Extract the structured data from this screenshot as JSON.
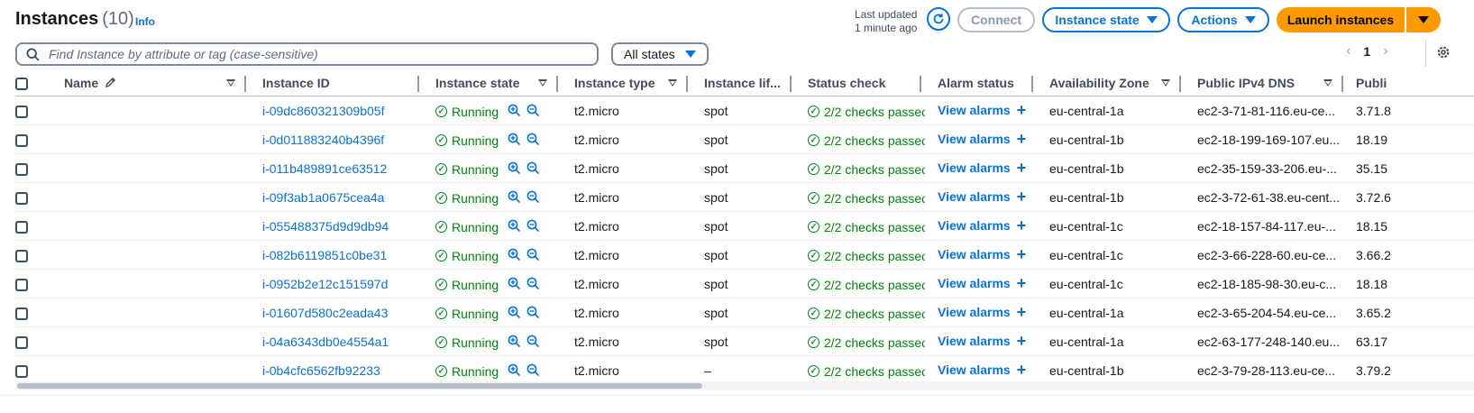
{
  "header": {
    "title": "Instances",
    "count": "(10)",
    "info": "Info",
    "last_updated_line1": "Last updated",
    "last_updated_line2": "1 minute ago",
    "connect": "Connect",
    "instance_state": "Instance state",
    "actions": "Actions",
    "launch": "Launch instances"
  },
  "search": {
    "placeholder": "Find Instance by attribute or tag (case-sensitive)"
  },
  "filter": {
    "selected": "All states"
  },
  "pagination": {
    "page": "1"
  },
  "columns": [
    "Name",
    "Instance ID",
    "Instance state",
    "Instance type",
    "Instance lif...",
    "Status check",
    "Alarm status",
    "Availability Zone",
    "Public IPv4 DNS",
    "Publi"
  ],
  "colors": {
    "link": "#0972d3",
    "success": "#037f0c",
    "primary": "#ff9900"
  },
  "rows": [
    {
      "id": "i-09dc860321309b05f",
      "state": "Running",
      "type": "t2.micro",
      "lifecycle": "spot",
      "status": "2/2 checks passec",
      "alarm": "View alarms",
      "az": "eu-central-1a",
      "dns": "ec2-3-71-81-116.eu-ce...",
      "ip": "3.71.8"
    },
    {
      "id": "i-0d011883240b4396f",
      "state": "Running",
      "type": "t2.micro",
      "lifecycle": "spot",
      "status": "2/2 checks passec",
      "alarm": "View alarms",
      "az": "eu-central-1b",
      "dns": "ec2-18-199-169-107.eu...",
      "ip": "18.19"
    },
    {
      "id": "i-011b489891ce63512",
      "state": "Running",
      "type": "t2.micro",
      "lifecycle": "spot",
      "status": "2/2 checks passec",
      "alarm": "View alarms",
      "az": "eu-central-1b",
      "dns": "ec2-35-159-33-206.eu-...",
      "ip": "35.15"
    },
    {
      "id": "i-09f3ab1a0675cea4a",
      "state": "Running",
      "type": "t2.micro",
      "lifecycle": "spot",
      "status": "2/2 checks passec",
      "alarm": "View alarms",
      "az": "eu-central-1b",
      "dns": "ec2-3-72-61-38.eu-cent...",
      "ip": "3.72.6"
    },
    {
      "id": "i-055488375d9d9db94",
      "state": "Running",
      "type": "t2.micro",
      "lifecycle": "spot",
      "status": "2/2 checks passec",
      "alarm": "View alarms",
      "az": "eu-central-1c",
      "dns": "ec2-18-157-84-117.eu-...",
      "ip": "18.15"
    },
    {
      "id": "i-082b6119851c0be31",
      "state": "Running",
      "type": "t2.micro",
      "lifecycle": "spot",
      "status": "2/2 checks passec",
      "alarm": "View alarms",
      "az": "eu-central-1c",
      "dns": "ec2-3-66-228-60.eu-ce...",
      "ip": "3.66.2"
    },
    {
      "id": "i-0952b2e12c151597d",
      "state": "Running",
      "type": "t2.micro",
      "lifecycle": "spot",
      "status": "2/2 checks passec",
      "alarm": "View alarms",
      "az": "eu-central-1c",
      "dns": "ec2-18-185-98-30.eu-c...",
      "ip": "18.18"
    },
    {
      "id": "i-01607d580c2eada43",
      "state": "Running",
      "type": "t2.micro",
      "lifecycle": "spot",
      "status": "2/2 checks passec",
      "alarm": "View alarms",
      "az": "eu-central-1a",
      "dns": "ec2-3-65-204-54.eu-ce...",
      "ip": "3.65.2"
    },
    {
      "id": "i-04a6343db0e4554a1",
      "state": "Running",
      "type": "t2.micro",
      "lifecycle": "spot",
      "status": "2/2 checks passec",
      "alarm": "View alarms",
      "az": "eu-central-1a",
      "dns": "ec2-63-177-248-140.eu...",
      "ip": "63.17"
    },
    {
      "id": "i-0b4cfc6562fb92233",
      "state": "Running",
      "type": "t2.micro",
      "lifecycle": "–",
      "status": "2/2 checks passec",
      "alarm": "View alarms",
      "az": "eu-central-1b",
      "dns": "ec2-3-79-28-113.eu-ce...",
      "ip": "3.79.2"
    }
  ]
}
